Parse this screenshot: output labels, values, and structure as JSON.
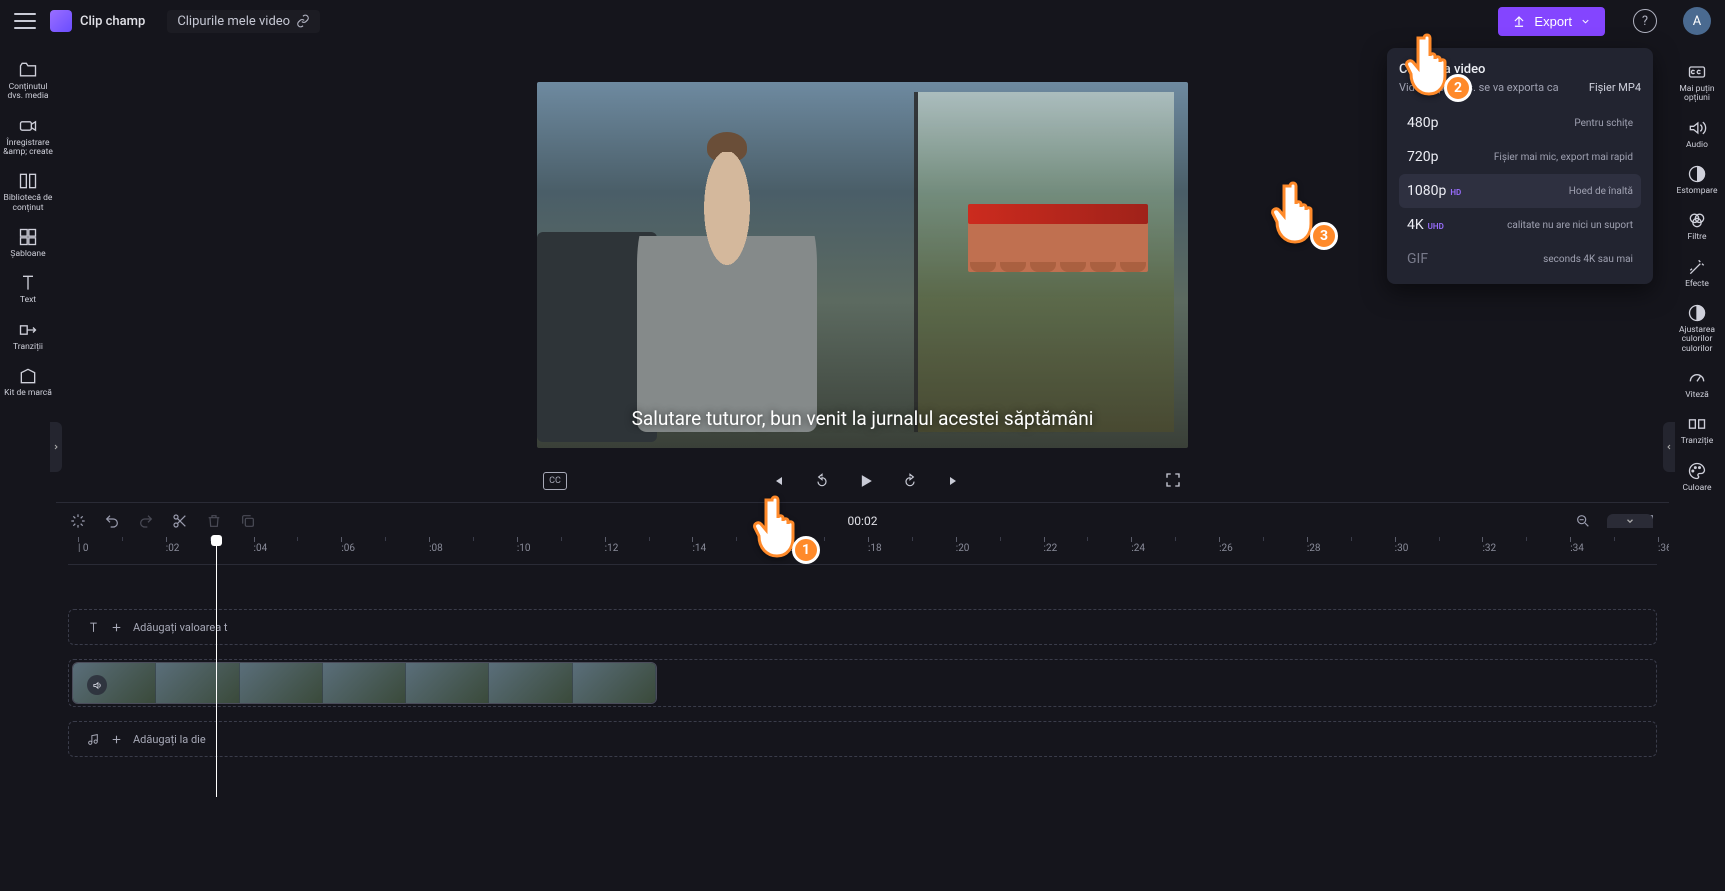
{
  "header": {
    "brand": "Clip champ",
    "breadcrumb": "Clipurile mele video",
    "export_label": "Export",
    "avatar_initial": "A"
  },
  "left_rail": {
    "items": [
      {
        "label": "Conținutul dvs. media"
      },
      {
        "label": "Înregistrare &amp; create"
      },
      {
        "label": "Bibliotecă de conținut"
      },
      {
        "label": "Șabloane"
      },
      {
        "label": "Text"
      },
      {
        "label": "Tranziții"
      },
      {
        "label": "Kit de marcă"
      }
    ]
  },
  "right_rail": {
    "items": [
      {
        "label": "Mai puțin opțiuni"
      },
      {
        "label": "Audio"
      },
      {
        "label": "Estompare"
      },
      {
        "label": "Filtre"
      },
      {
        "label": "Efecte"
      },
      {
        "label": "Ajustarea culorilor culorilor"
      },
      {
        "label": "Viteză"
      },
      {
        "label": "Tranziție"
      },
      {
        "label": "Culoare"
      }
    ]
  },
  "preview": {
    "caption": "Salutare tuturor, bun venit la jurnalul acestei săptămâni",
    "cc_label": "CC",
    "time_current": "00:02",
    "time_total": ""
  },
  "export_popover": {
    "title": "Calitatea video",
    "subtitle": "Videoclipul dvs. se va exporta ca",
    "format": "Fișier MP4",
    "options": [
      {
        "name": "480p",
        "badge": "",
        "desc": "Pentru schițe"
      },
      {
        "name": "720p",
        "badge": "",
        "desc": "Fișier mai mic, export mai rapid"
      },
      {
        "name": "1080p",
        "badge": "HD",
        "desc": "Hoed de înaltă"
      },
      {
        "name": "4K",
        "badge": "UHD",
        "desc": "calitate nu are nici un suport"
      },
      {
        "name": "GIF",
        "badge": "",
        "desc": "seconds 4K sau mai"
      }
    ]
  },
  "timeline": {
    "text_track_label": "Adăugați valoarea t",
    "audio_track_label": "Adăugați la die",
    "ticks": [
      "0",
      ":02",
      ":04",
      ":06",
      ":08",
      ":10",
      ":12",
      ":14",
      ":16",
      ":18",
      ":20",
      ":22",
      ":24",
      ":26",
      ":28",
      ":30",
      ":32",
      ":34",
      ":36"
    ]
  },
  "annotations": {
    "step1": "1",
    "step2": "2",
    "step3": "3"
  }
}
